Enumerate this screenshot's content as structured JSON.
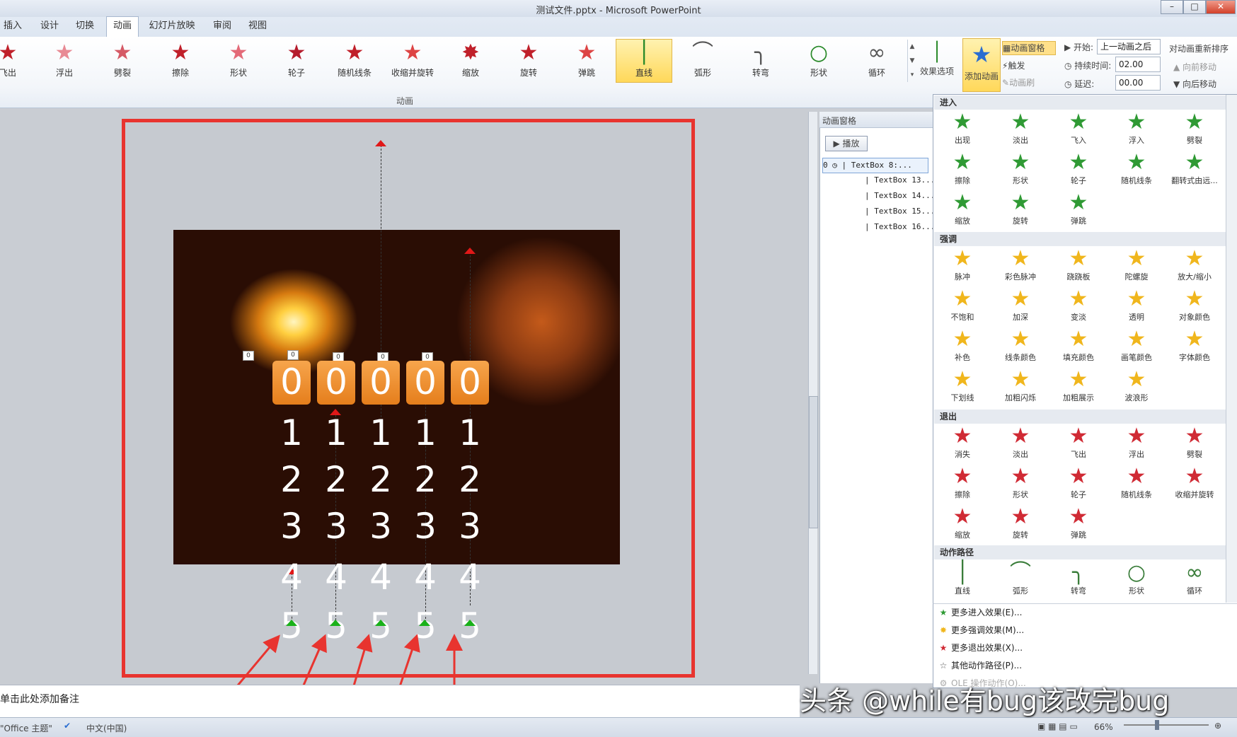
{
  "window": {
    "title": "测试文件.pptx - Microsoft PowerPoint",
    "min": "–",
    "max": "□",
    "close": "✕"
  },
  "tabs": [
    "插入",
    "设计",
    "切换",
    "动画",
    "幻灯片放映",
    "审阅",
    "视图"
  ],
  "active_tab": "动画",
  "ribbon": {
    "effects": [
      {
        "label": "飞出",
        "icon": "★"
      },
      {
        "label": "浮出",
        "icon": "★"
      },
      {
        "label": "劈裂",
        "icon": "★"
      },
      {
        "label": "擦除",
        "icon": "★"
      },
      {
        "label": "形状",
        "icon": "★"
      },
      {
        "label": "轮子",
        "icon": "★"
      },
      {
        "label": "随机线条",
        "icon": "★"
      },
      {
        "label": "收缩并旋转",
        "icon": "★"
      },
      {
        "label": "缩放",
        "icon": "✸"
      },
      {
        "label": "旋转",
        "icon": "★"
      },
      {
        "label": "弹跳",
        "icon": "★"
      },
      {
        "label": "直线",
        "icon": "│"
      },
      {
        "label": "弧形",
        "icon": "⌒"
      },
      {
        "label": "转弯",
        "icon": "╮"
      },
      {
        "label": "形状",
        "icon": "○"
      },
      {
        "label": "循环",
        "icon": "∞"
      }
    ],
    "selected_effect": "直线",
    "group_label": "动画",
    "effect_options": "效果选项",
    "add_animation": "添加动画",
    "animation_pane": "动画窗格",
    "trigger": "触发",
    "animation_painter": "动画刷",
    "start_label": "开始:",
    "start_value": "上一动画之后",
    "duration_label": "持续时间:",
    "duration_value": "02.00",
    "delay_label": "延迟:",
    "delay_value": "00.00",
    "reorder_title": "对动画重新排序",
    "move_earlier": "向前移动",
    "move_later": "向后移动"
  },
  "anim_pane": {
    "title": "动画窗格",
    "play": "播放",
    "items": [
      "0 ◷ | TextBox 8:...",
      "| TextBox 13...",
      "| TextBox 14...",
      "| TextBox 15...",
      "| TextBox 16..."
    ]
  },
  "gallery": {
    "enter_title": "进入",
    "enter": [
      "出现",
      "淡出",
      "飞入",
      "浮入",
      "劈裂",
      "擦除",
      "形状",
      "轮子",
      "随机线条",
      "翻转式由远...",
      "缩放",
      "旋转",
      "弹跳"
    ],
    "emph_title": "强调",
    "emph": [
      "脉冲",
      "彩色脉冲",
      "跷跷板",
      "陀螺旋",
      "放大/缩小",
      "不饱和",
      "加深",
      "变淡",
      "透明",
      "对象颜色",
      "补色",
      "线条颜色",
      "填充颜色",
      "画笔颜色",
      "字体颜色",
      "下划线",
      "加粗闪烁",
      "加粗展示",
      "波浪形"
    ],
    "exit_title": "退出",
    "exit": [
      "消失",
      "淡出",
      "飞出",
      "浮出",
      "劈裂",
      "擦除",
      "形状",
      "轮子",
      "随机线条",
      "收缩并旋转",
      "缩放",
      "旋转",
      "弹跳"
    ],
    "path_title": "动作路径",
    "path": [
      "直线",
      "弧形",
      "转弯",
      "形状",
      "循环"
    ],
    "more": [
      "更多进入效果(E)...",
      "更多强调效果(M)...",
      "更多退出效果(X)...",
      "其他动作路径(P)...",
      "OLE 操作动作(O)..."
    ]
  },
  "slide": {
    "digits": [
      "0",
      "1",
      "2",
      "3",
      "4",
      "5"
    ],
    "tags": [
      "0",
      "0",
      "0",
      "0",
      "0",
      "0"
    ]
  },
  "notes": "单击此处添加备注",
  "status": {
    "theme": "\"Office 主题\"",
    "lang": "中文(中国)",
    "zoom": "66%"
  },
  "watermark": "头条 @while有bug该改完bug"
}
